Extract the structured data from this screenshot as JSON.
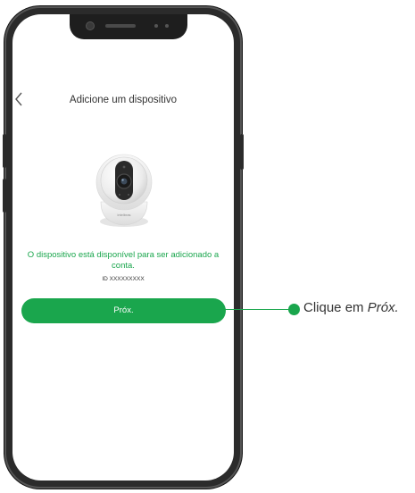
{
  "screen": {
    "title": "Adicione um dispositivo",
    "back_icon": "chevron-left-icon",
    "device_brand": "intelbras",
    "available_message": "O dispositivo está disponível para ser adicionado a conta.",
    "device_id": "ID XXXXXXXXX",
    "next_button_label": "Próx."
  },
  "callout": {
    "prefix": "Clique em ",
    "emphasis": "Próx."
  },
  "colors": {
    "accent": "#1aa64d",
    "text": "#333333",
    "frame": "#2b2b2b"
  }
}
